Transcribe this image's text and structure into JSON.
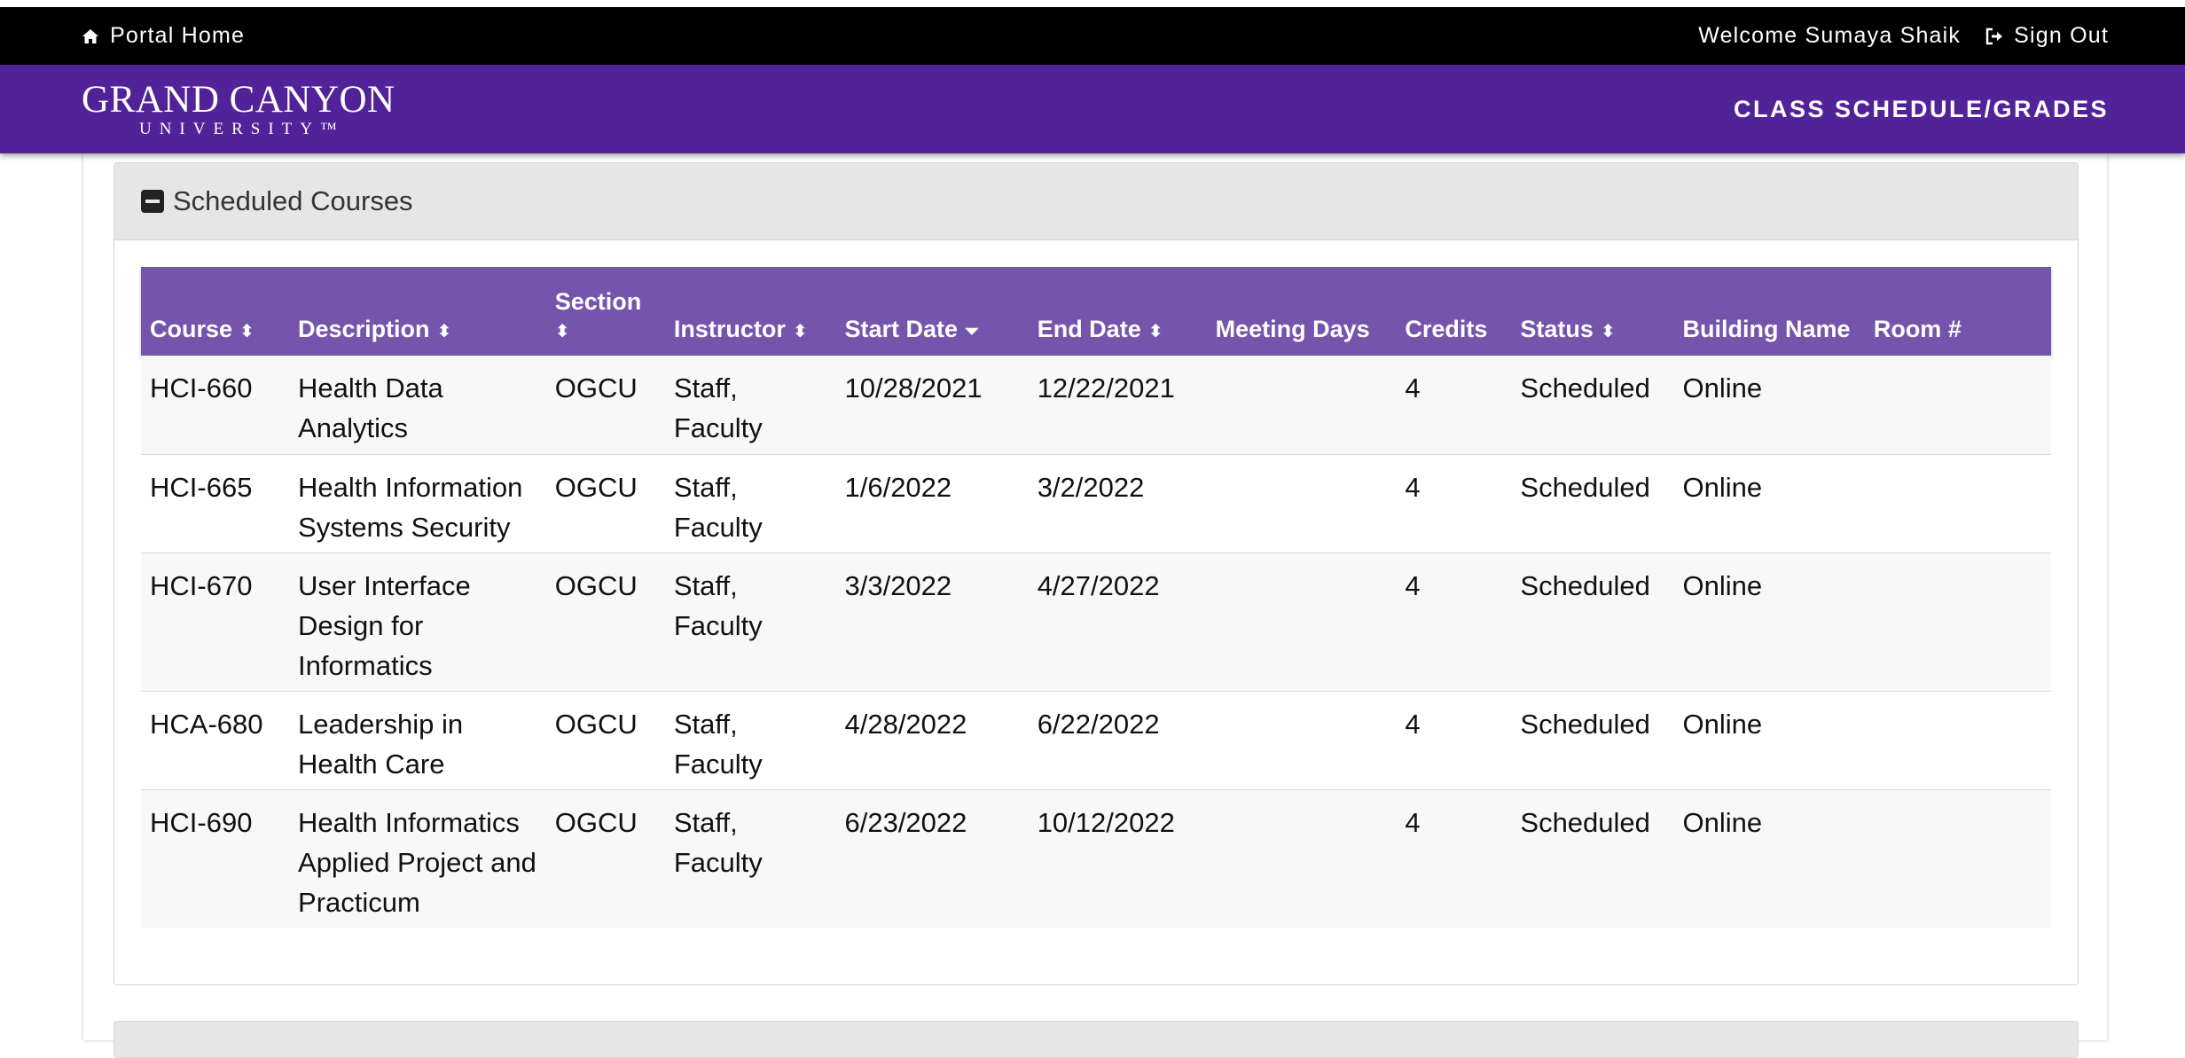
{
  "topbar": {
    "portal_home_icon": "home-icon",
    "portal_home_label": "Portal Home",
    "welcome_text": "Welcome Sumaya Shaik",
    "sign_out_icon": "sign-out-icon",
    "sign_out_label": "Sign Out"
  },
  "brand": {
    "logo_line1": "GRAND CANYON",
    "logo_line2": "UNIVERSITY™",
    "page_heading": "CLASS SCHEDULE/GRADES",
    "color": "#522398"
  },
  "panel": {
    "title": "Scheduled Courses",
    "collapse_icon": "minus-square-icon"
  },
  "table": {
    "header_color": "#7554ab",
    "columns": [
      {
        "label": "Course",
        "sort": "both"
      },
      {
        "label": "Description",
        "sort": "both"
      },
      {
        "label": "Section",
        "sort": "both"
      },
      {
        "label": "Instructor",
        "sort": "both"
      },
      {
        "label": "Start Date",
        "sort": "desc"
      },
      {
        "label": "End Date",
        "sort": "both"
      },
      {
        "label": "Meeting Days",
        "sort": "none"
      },
      {
        "label": "Credits",
        "sort": "none"
      },
      {
        "label": "Status",
        "sort": "both"
      },
      {
        "label": "Building Name",
        "sort": "none"
      },
      {
        "label": "Room #",
        "sort": "none"
      }
    ],
    "rows": [
      {
        "course": "HCI-660",
        "description": "Health Data Analytics",
        "section": "OGCU",
        "instructor": "Staff, Faculty",
        "start": "10/28/2021",
        "end": "12/22/2021",
        "meeting_days": "",
        "credits": "4",
        "status": "Scheduled",
        "building": "Online",
        "room": ""
      },
      {
        "course": "HCI-665",
        "description": "Health Information Systems Security",
        "section": "OGCU",
        "instructor": "Staff, Faculty",
        "start": "1/6/2022",
        "end": "3/2/2022",
        "meeting_days": "",
        "credits": "4",
        "status": "Scheduled",
        "building": "Online",
        "room": ""
      },
      {
        "course": "HCI-670",
        "description": "User Interface Design for Informatics",
        "section": "OGCU",
        "instructor": "Staff, Faculty",
        "start": "3/3/2022",
        "end": "4/27/2022",
        "meeting_days": "",
        "credits": "4",
        "status": "Scheduled",
        "building": "Online",
        "room": ""
      },
      {
        "course": "HCA-680",
        "description": "Leadership in Health Care",
        "section": "OGCU",
        "instructor": "Staff, Faculty",
        "start": "4/28/2022",
        "end": "6/22/2022",
        "meeting_days": "",
        "credits": "4",
        "status": "Scheduled",
        "building": "Online",
        "room": ""
      },
      {
        "course": "HCI-690",
        "description": "Health Informatics Applied Project and Practicum",
        "section": "OGCU",
        "instructor": "Staff, Faculty",
        "start": "6/23/2022",
        "end": "10/12/2022",
        "meeting_days": "",
        "credits": "4",
        "status": "Scheduled",
        "building": "Online",
        "room": ""
      }
    ]
  }
}
